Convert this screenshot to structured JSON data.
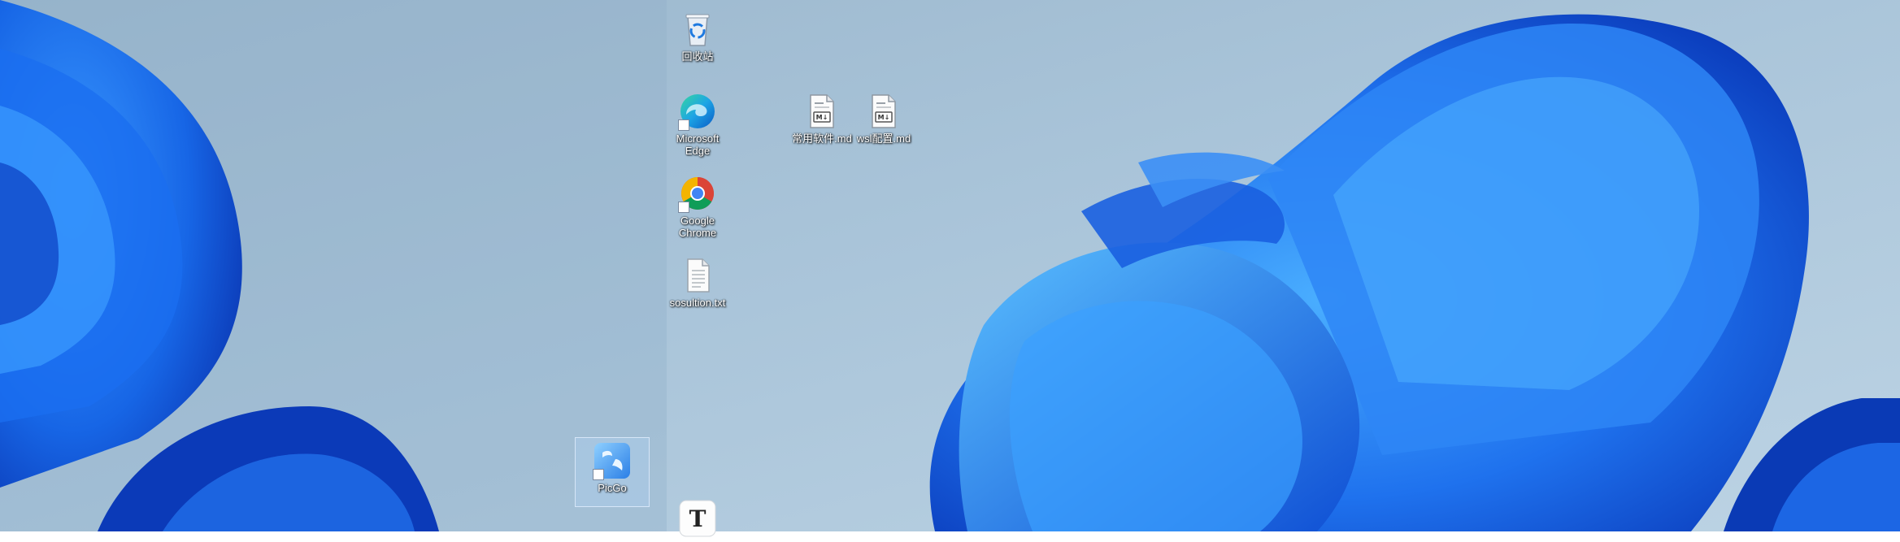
{
  "desktop": {
    "colors": {
      "background": "#a9c3d8",
      "bloom_dark": "#0a3fc4",
      "bloom_light": "#2f8cf5"
    },
    "icons": [
      {
        "label": "回收站",
        "icon": "recycle-bin-icon"
      },
      {
        "label": "Microsoft Edge",
        "icon": "edge-icon"
      },
      {
        "label": "Google Chrome",
        "icon": "chrome-icon"
      },
      {
        "label": "sosultion.txt",
        "icon": "text-file-icon"
      },
      {
        "label": "常用软件.md",
        "icon": "markdown-file-icon"
      },
      {
        "label": "wsl配置.md",
        "icon": "markdown-file-icon"
      },
      {
        "label": "PicGo",
        "icon": "picgo-icon"
      },
      {
        "label": "",
        "icon": "typora-icon"
      }
    ]
  }
}
